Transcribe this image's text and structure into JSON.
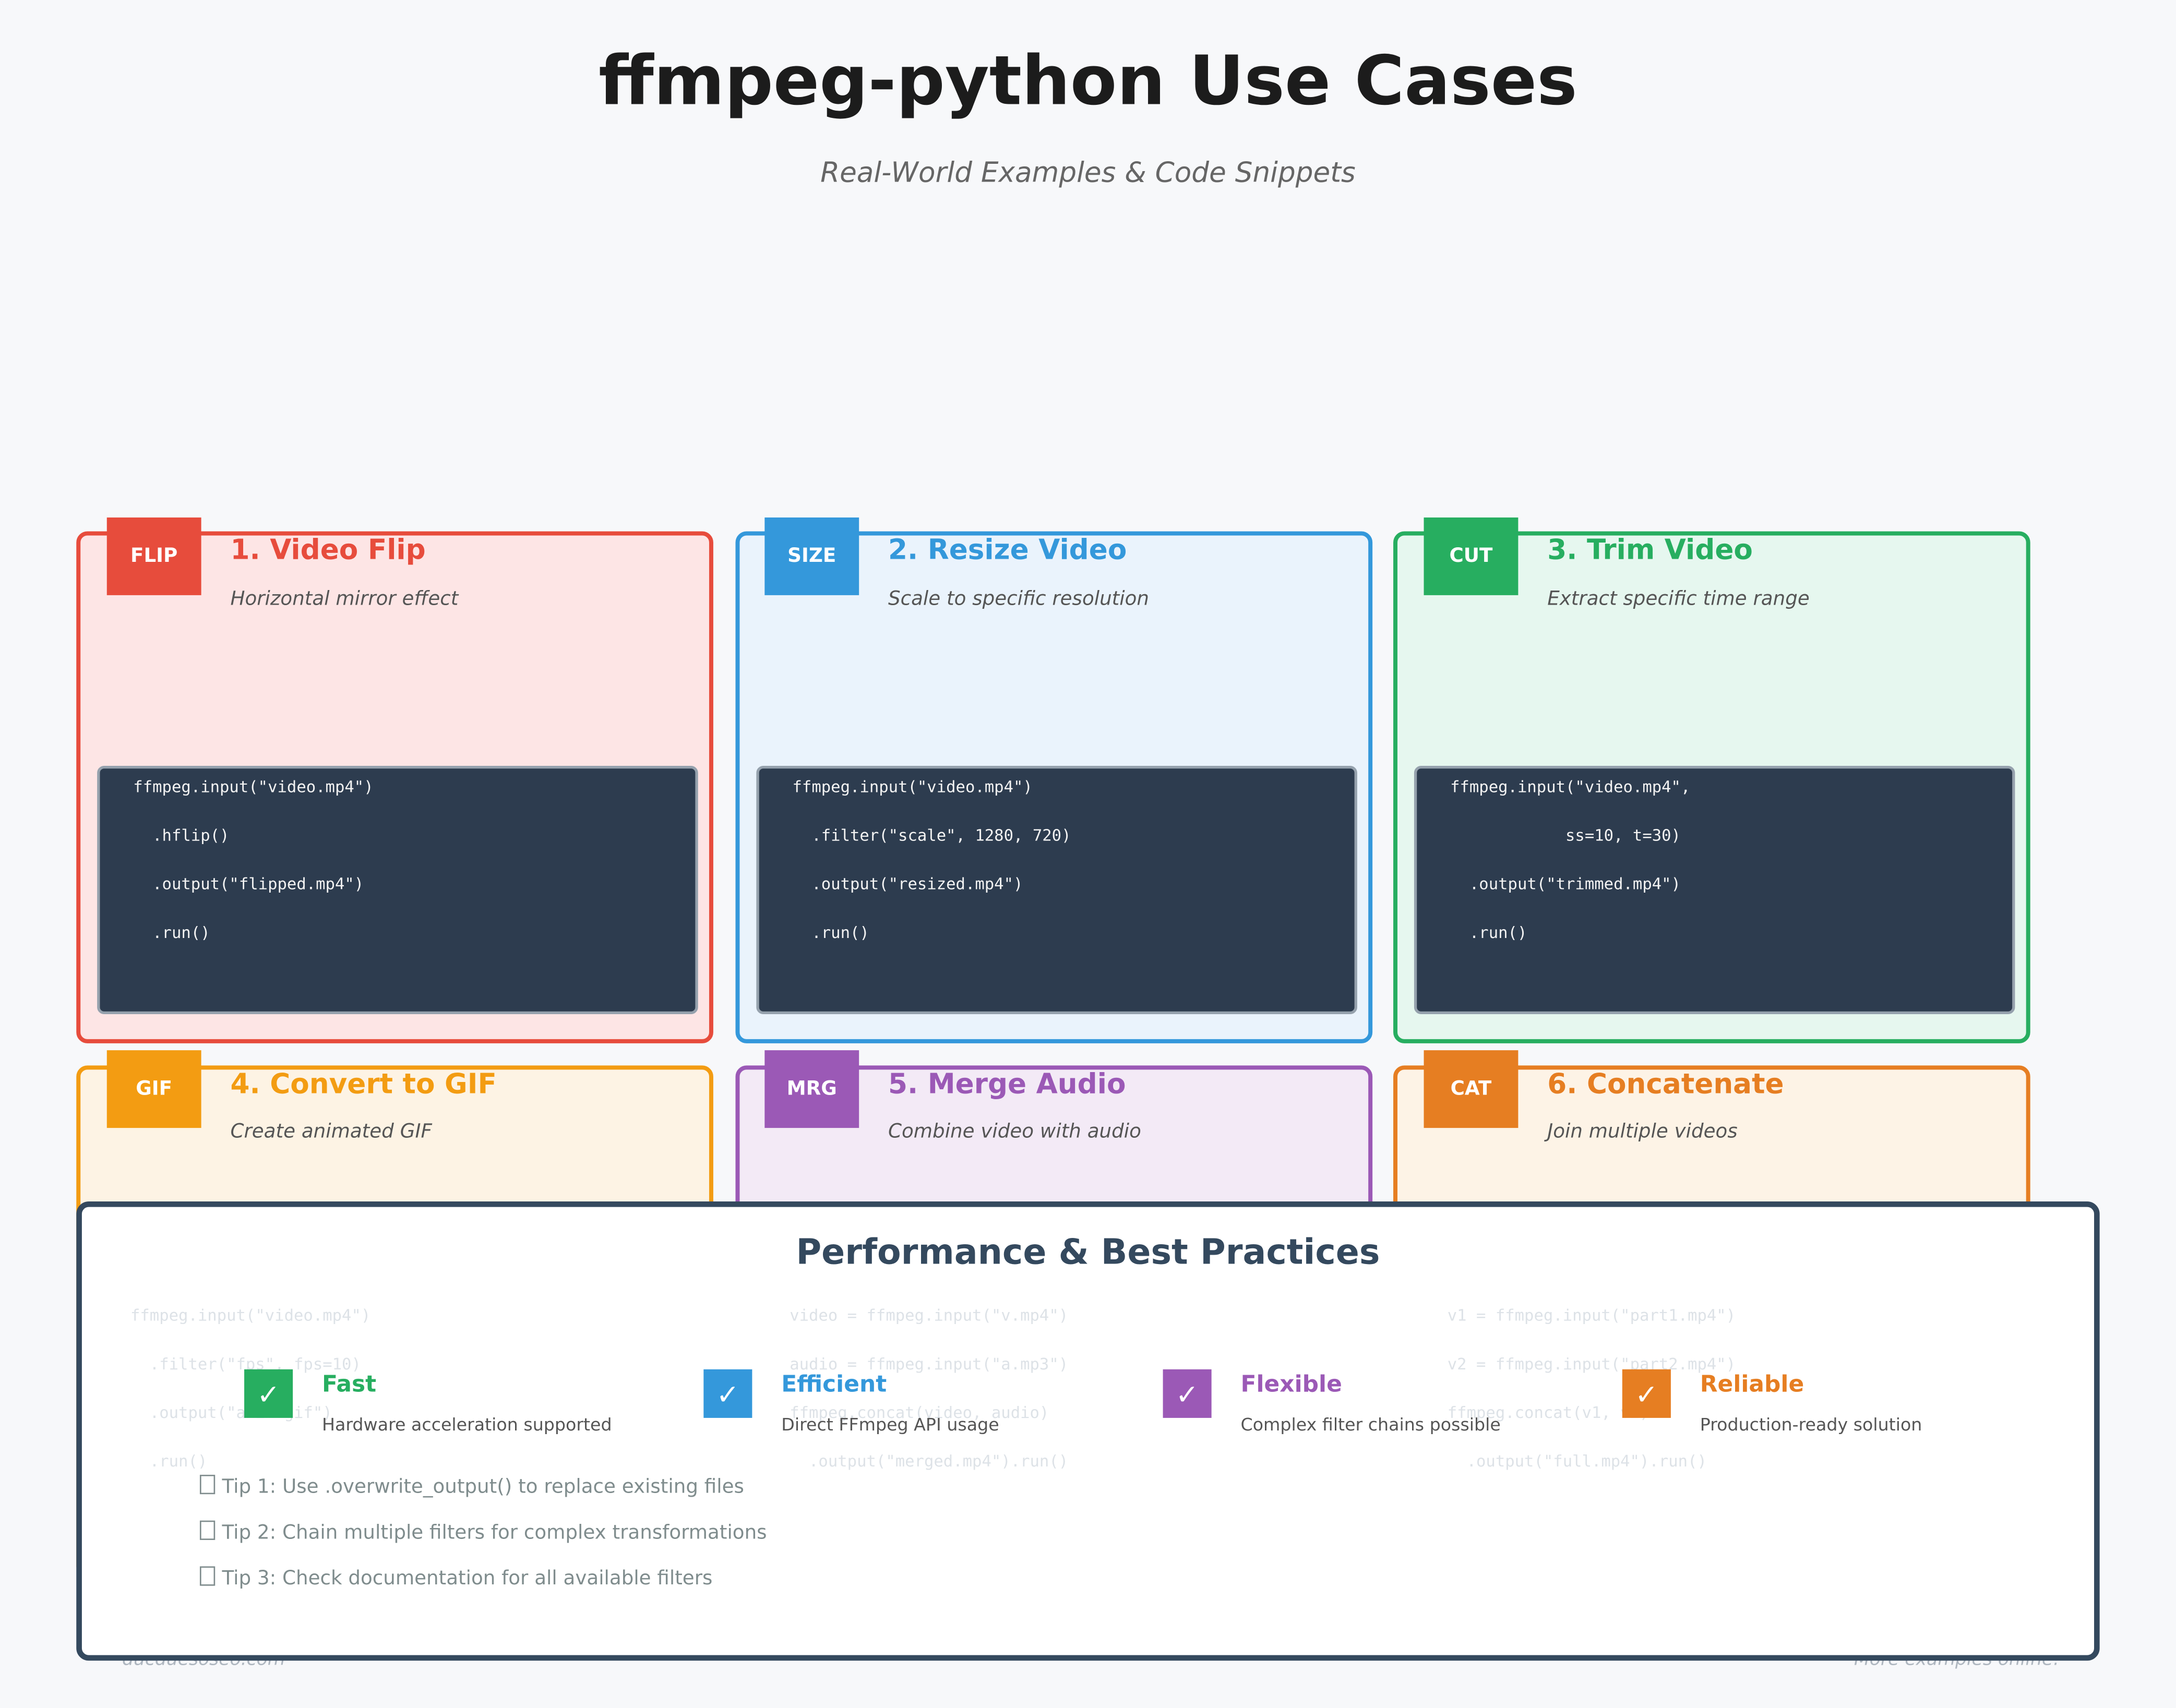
{
  "header": {
    "title": "ffmpeg-python Use Cases",
    "subtitle": "Real-World Examples & Code Snippets"
  },
  "cards": [
    {
      "badge": "FLIP",
      "title": "1. Video Flip",
      "desc": "Horizontal mirror effect",
      "color": "#e74c3c",
      "bg": "#fde5e5",
      "code": [
        "ffmpeg.input(\"video.mp4\")",
        "  .hflip()",
        "  .output(\"flipped.mp4\")",
        "  .run()"
      ]
    },
    {
      "badge": "SIZE",
      "title": "2. Resize Video",
      "desc": "Scale to specific resolution",
      "color": "#3498db",
      "bg": "#eaf3fc",
      "code": [
        "ffmpeg.input(\"video.mp4\")",
        "  .filter(\"scale\", 1280, 720)",
        "  .output(\"resized.mp4\")",
        "  .run()"
      ]
    },
    {
      "badge": "CUT",
      "title": "3. Trim Video",
      "desc": "Extract specific time range",
      "color": "#27ae60",
      "bg": "#e6f7ef",
      "code": [
        "ffmpeg.input(\"video.mp4\",",
        "            ss=10, t=30)",
        "  .output(\"trimmed.mp4\")",
        "  .run()"
      ]
    },
    {
      "badge": "GIF",
      "title": "4. Convert to GIF",
      "desc": "Create animated GIF",
      "color": "#f39c12",
      "bg": "#fdf3e4",
      "code": [
        "ffmpeg.input(\"video.mp4\")",
        "  .filter(\"fps\", fps=10)",
        "  .output(\"anim.gif\")",
        "  .run()"
      ]
    },
    {
      "badge": "MRG",
      "title": "5. Merge Audio",
      "desc": "Combine video with audio",
      "color": "#9b59b6",
      "bg": "#f3eaf6",
      "code": [
        "video = ffmpeg.input(\"v.mp4\")",
        "audio = ffmpeg.input(\"a.mp3\")",
        "ffmpeg.concat(video, audio)",
        "  .output(\"merged.mp4\").run()"
      ]
    },
    {
      "badge": "CAT",
      "title": "6. Concatenate",
      "desc": "Join multiple videos",
      "color": "#e67e22",
      "bg": "#fdf3e6",
      "code": [
        "v1 = ffmpeg.input(\"part1.mp4\")",
        "v2 = ffmpeg.input(\"part2.mp4\")",
        "ffmpeg.concat(v1, v2)",
        "  .output(\"full.mp4\").run()"
      ]
    }
  ],
  "practices": {
    "title": "Performance & Best Practices",
    "check": "✓",
    "features": [
      {
        "name": "Fast",
        "desc": "Hardware acceleration supported",
        "color": "#27ae60"
      },
      {
        "name": "Efficient",
        "desc": "Direct FFmpeg API usage",
        "color": "#3498db"
      },
      {
        "name": "Flexible",
        "desc": "Complex filter chains possible",
        "color": "#9b59b6"
      },
      {
        "name": "Reliable",
        "desc": "Production-ready solution",
        "color": "#e67e22"
      }
    ],
    "tips": [
      "Tip 1: Use .overwrite_output() to replace existing files",
      "Tip 2: Chain multiple filters for complex transformations",
      "Tip 3: Check documentation for all available filters"
    ]
  },
  "footer": {
    "left": "ducduesoseo.com",
    "right": "More examples online!"
  }
}
